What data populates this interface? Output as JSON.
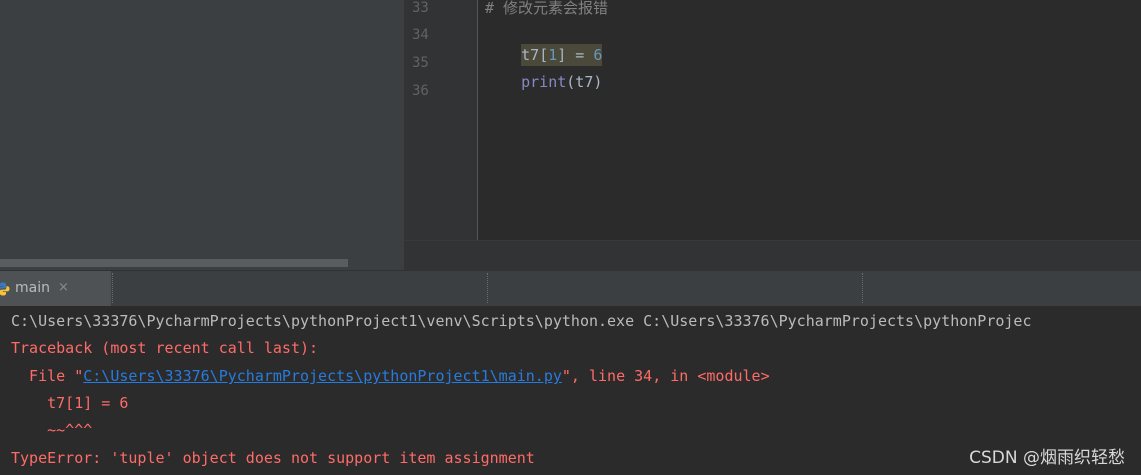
{
  "editor": {
    "lines": [
      {
        "num": "33",
        "text": "# 修改元素会报错"
      },
      {
        "num": "34",
        "var": "t7",
        "open": "[",
        "index": "1",
        "close": "]",
        "op": " = ",
        "value": "6"
      },
      {
        "num": "35",
        "func": "print",
        "args": "(t7)"
      },
      {
        "num": "36"
      }
    ]
  },
  "run": {
    "tab_label": "main",
    "tab_close": "×",
    "tab_icon": "python-icon"
  },
  "console": {
    "command": "C:\\Users\\33376\\PycharmProjects\\pythonProject1\\venv\\Scripts\\python.exe C:\\Users\\33376\\PycharmProjects\\pythonProjec",
    "traceback": "Traceback (most recent call last):",
    "file_prefix": "  File \"",
    "file_path": "C:\\Users\\33376\\PycharmProjects\\pythonProject1\\main.py",
    "file_suffix": "\", line 34, in <module>",
    "code_line": "    t7[1] = 6",
    "caret_line": "    ~~^^^",
    "error": "TypeError: 'tuple' object does not support item assignment"
  },
  "watermark": "CSDN @烟雨织轻愁",
  "colors": {
    "error": "#ff6b68",
    "link": "#287bde",
    "background": "#2b2b2b"
  }
}
